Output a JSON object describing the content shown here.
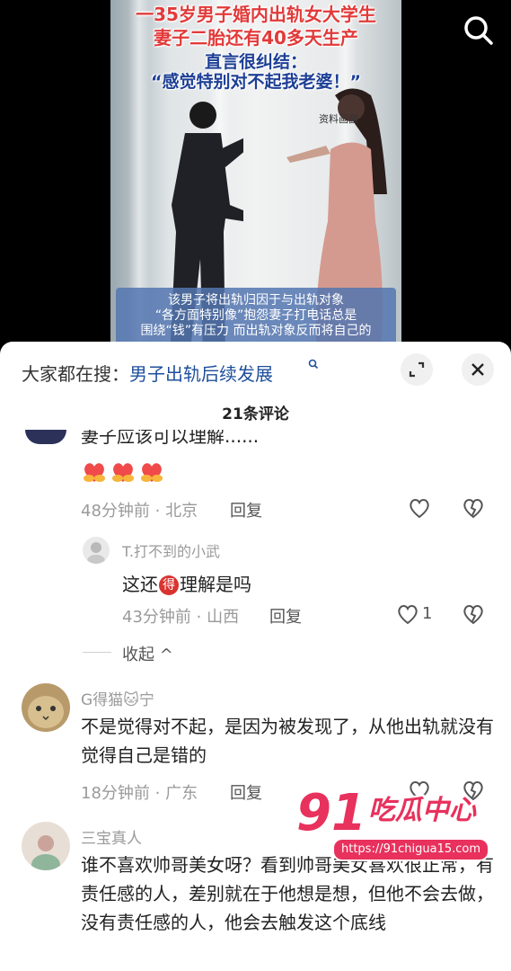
{
  "video": {
    "headline_line1": "一35岁男子婚内出轨女大学生",
    "headline_line2": "妻子二胎还有40多天生产",
    "subline1": "直言很纠结：",
    "subline2": "“感觉特别对不起我老婆！”",
    "source_label": "资料画面",
    "caption_line1": "该男子将出轨归因于与出轨对象",
    "caption_line2": "“各方面特别像”抱怨妻子打电话总是",
    "caption_line3": "围绕“钱”有压力 而出轨对象反而将自己的",
    "search_icon": "search-icon"
  },
  "sheet": {
    "trending_prefix": "大家都在搜：",
    "trending_keyword": "男子出轨后续发展",
    "comment_count_label": "21条评论"
  },
  "comments": {
    "top_partial_text": "妻子应该可以理解......",
    "top_meta": "48分钟前 · 北京",
    "reply_label": "回复",
    "reply": {
      "name": "T.打不到的小武",
      "text_before": "这还",
      "badge": "得",
      "text_after": "理解是吗",
      "meta": "43分钟前 · 山西",
      "like_count": "1"
    },
    "collapse_label": "收起 ^",
    "c1": {
      "name": "G得猫🐱宁",
      "text": "不是觉得对不起，是因为被发现了，从他出轨就没有觉得自己是错的",
      "meta": "18分钟前 · 广东"
    },
    "c2": {
      "name": "三宝真人",
      "text": "谁不喜欢帅哥美女呀？看到帅哥美女喜欢很正常，有责任感的人，差别就在于他想是想，但他不会去做，没有责任感的人，他会去触发这个底线"
    }
  },
  "watermark": {
    "logo_num": "91",
    "logo_text": "吃瓜中心",
    "url": "https://91chigua15.com"
  },
  "colors": {
    "accent_link": "#1e4f9c",
    "headline_red": "#e23a3a",
    "watermark_pink": "#e8315c"
  }
}
